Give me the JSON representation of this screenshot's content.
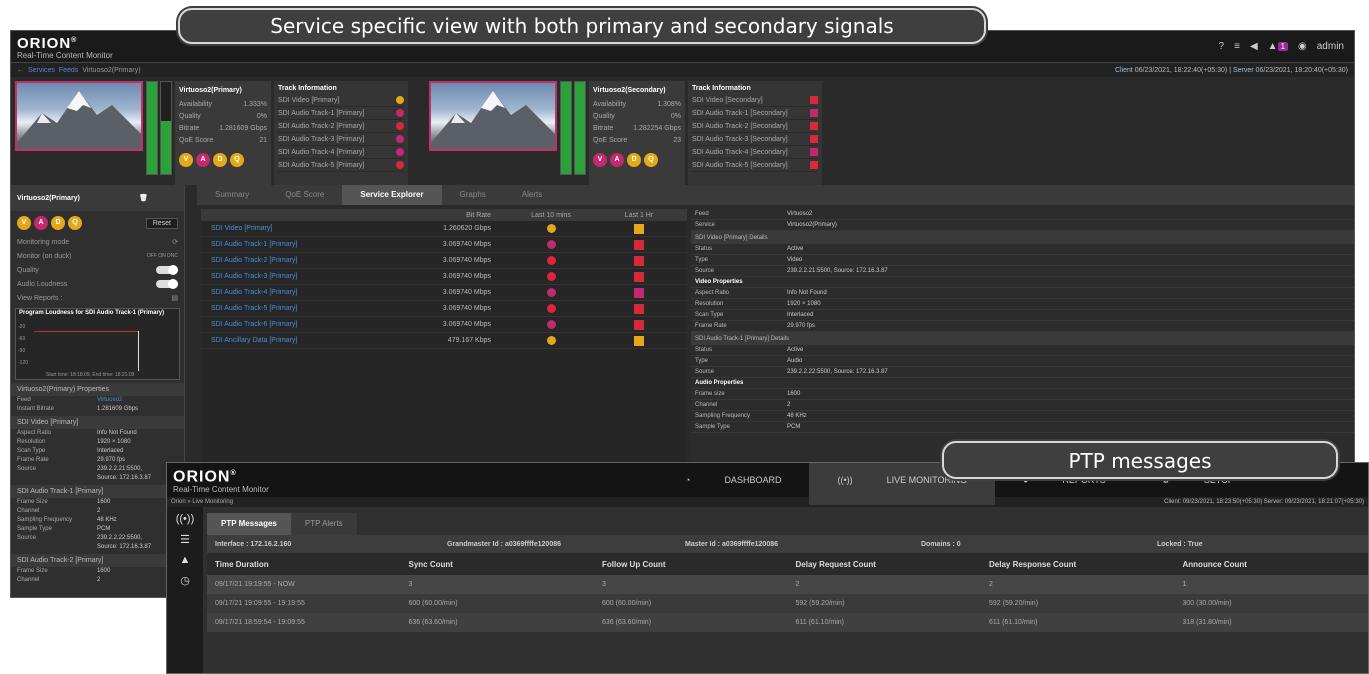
{
  "callouts": {
    "main": "Service specific view with both primary and secondary signals",
    "ptp": "PTP messages"
  },
  "app": {
    "logo": "ORION",
    "reg": "®",
    "subtitle": "Real-Time Content Monitor",
    "user": "admin",
    "badge": "1"
  },
  "breadcrumb": {
    "services": "Services",
    "feeds": "Feeds",
    "current": "Virtuoso2(Primary)"
  },
  "clock": {
    "client_label": "Client",
    "client": "06/23/2021, 18:22:40(+05:30)",
    "server_label": "Server",
    "server": "06/23/2021, 18:20:40(+05:30)"
  },
  "primary": {
    "name": "Virtuoso2(Primary)",
    "availability_label": "Availability",
    "availability": "1.333%",
    "quality_label": "Quality",
    "quality": "0%",
    "bitrate_label": "Bitrate",
    "bitrate": "1.281609 Gbps",
    "qos_label": "QoE Score",
    "qos": "21",
    "track_title": "Track Information",
    "tracks": [
      "SDI Video [Primary]",
      "SDI Audio Track-1 [Primary]",
      "SDI Audio Track-2 [Primary]",
      "SDI Audio Track-3 [Primary]",
      "SDI Audio Track-4 [Primary]",
      "SDI Audio Track-5 [Primary]"
    ]
  },
  "secondary": {
    "name": "Virtuoso2(Secondary)",
    "availability_label": "Availability",
    "availability": "1.308%",
    "quality_label": "Quality",
    "quality": "0%",
    "bitrate_label": "Bitrate",
    "bitrate": "1.282254 Gbps",
    "qos_label": "QoE Score",
    "qos": "23",
    "track_title": "Track Information",
    "tracks": [
      "SDI Video [Secondary]",
      "SDI Audio Track-1 [Secondary]",
      "SDI Audio Track-2 [Secondary]",
      "SDI Audio Track-3 [Secondary]",
      "SDI Audio Track-4 [Secondary]",
      "SDI Audio Track-5 [Secondary]"
    ]
  },
  "vadq": [
    "V",
    "A",
    "D",
    "Q"
  ],
  "left": {
    "title": "Virtuoso2(Primary)",
    "reset": "Reset",
    "monitoring_mode": "Monitoring mode",
    "monitor_duck": "Monitor (on duck)",
    "duck_opts": "OFF ON DNC",
    "quality": "Quality",
    "audio_loudness": "Audio Loudness",
    "view_reports": "View Reports :",
    "graph_title": "Program Loudness for SDI Audio Track-1 (Primary)",
    "graph_y": [
      "-20",
      "-60",
      "-90",
      "-120"
    ],
    "graph_ylabel": "LKFS",
    "graph_time": "Start time: 18:18:09, End time: 18:21:09",
    "props_title": "Virtuoso2(Primary) Properties",
    "feed_k": "Feed",
    "feed_v": "Virtuoso2",
    "instant_bitrate_k": "Instant Bitrate",
    "instant_bitrate_v": "1.281609 Gbps",
    "video_sect": "SDI Video [Primary]",
    "aspect_k": "Aspect Ratio",
    "aspect_v": "Info Not Found",
    "res_k": "Resolution",
    "res_v": "1920 × 1080",
    "scan_k": "Scan Type",
    "scan_v": "Interlaced",
    "frame_k": "Frame Rate",
    "frame_v": "29.970 fps",
    "source_k": "Source",
    "source_v": "239.2.2.21:5500, Source: 172.16.3.87",
    "a1_sect": "SDI Audio Track-1 [Primary]",
    "fsize_k": "Frame Size",
    "fsize_v": "1600",
    "chan_k": "Channel",
    "chan_v": "2",
    "sfreq_k": "Sampling Frequency",
    "sfreq_v": "48 KHz",
    "stype_k": "Sample Type",
    "stype_v": "PCM",
    "a1_source_v": "239.2.2.22:5500, Source: 172.16.3.87",
    "a2_sect": "SDI Audio Track-2 [Primary]",
    "a2_fsize_v": "1600",
    "a2_chan_v": "2"
  },
  "center_tabs": [
    "Summary",
    "QoE Score",
    "Service Explorer",
    "Graphs",
    "Alerts"
  ],
  "explorer": {
    "headers": [
      "",
      "Bit Rate",
      "Last 10 mins",
      "Last 1 Hr"
    ],
    "rows": [
      {
        "name": "SDI Video [Primary]",
        "rate": "1.260620 Gbps",
        "c10": "#e4a818",
        "c1h": "#e4a818",
        "shape10": "dot"
      },
      {
        "name": "SDI Audio Track-1 [Primary]",
        "rate": "3.069740 Mbps",
        "c10": "#c2296e",
        "c1h": "#d9283a",
        "shape10": "dot"
      },
      {
        "name": "SDI Audio Track-2 [Primary]",
        "rate": "3.069740 Mbps",
        "c10": "#d9283a",
        "c1h": "#d9283a",
        "shape10": "dot"
      },
      {
        "name": "SDI Audio Track-3 [Primary]",
        "rate": "3.069740 Mbps",
        "c10": "#d9283a",
        "c1h": "#d9283a",
        "shape10": "dot"
      },
      {
        "name": "SDI Audio Track-4 [Primary]",
        "rate": "3.069740 Mbps",
        "c10": "#c2296e",
        "c1h": "#c2296e",
        "shape10": "dot"
      },
      {
        "name": "SDI Audio Track-5 [Primary]",
        "rate": "3.069740 Mbps",
        "c10": "#d9283a",
        "c1h": "#d9283a",
        "shape10": "dot"
      },
      {
        "name": "SDI Audio Track-6 [Primary]",
        "rate": "3.069740 Mbps",
        "c10": "#c2296e",
        "c1h": "#d9283a",
        "shape10": "dot"
      },
      {
        "name": "SDI Ancillary Data [Primary]",
        "rate": "479.167 Kbps",
        "c10": "#e4a818",
        "c1h": "#e4a818",
        "shape10": "dot"
      }
    ]
  },
  "details": {
    "feed_k": "Feed",
    "feed_v": "Virtuoso2",
    "service_k": "Service",
    "service_v": "Virtuoso2(Primary)",
    "video_sect": "SDI Video [Primary] Details",
    "status_k": "Status",
    "status_v": "Active",
    "type_k": "Type",
    "type_v": "Video",
    "source_k": "Source",
    "source_v": "239.2.2.21:5500, Source: 172.16.3.87",
    "vprops": "Video Properties",
    "aspect_k": "Aspect Ratio",
    "aspect_v": "Info Not Found",
    "res_k": "Resolution",
    "res_v": "1920 × 1080",
    "scan_k": "Scan Type",
    "scan_v": "Interlaced",
    "frame_k": "Frame Rate",
    "frame_v": "29.970 fps",
    "a1_sect": "SDI Audio Track-1 [Primary] Details",
    "a_status_v": "Active",
    "a_type_v": "Audio",
    "a_source_v": "239.2.2.22:5500, Source: 172.16.3.87",
    "aprops": "Audio Properties",
    "fsize_k": "Frame size",
    "fsize_v": "1600",
    "chan_k": "Channel",
    "chan_v": "2",
    "sfreq_k": "Sampling Frequency",
    "sfreq_v": "48 KHz",
    "stype_k": "Sample Type",
    "stype_v": "PCM"
  },
  "ptp": {
    "logo": "ORION",
    "subtitle": "Real-Time Content Monitor",
    "nav": [
      "DASHBOARD",
      "LIVE MONITORING",
      "REPORTS",
      "SETUP"
    ],
    "crumb": "Orion » Live Monitoring",
    "clock": "Client: 09/23/2021, 18:23:50(+05:30)  Server: 09/23/2021, 18:21:07(+05:30)",
    "tabs": [
      "PTP Messages",
      "PTP Alerts"
    ],
    "interface": "Interface : 172.16.2.160",
    "grandmaster": "Grandmaster Id : a0369ffffe120086",
    "master": "Master Id : a0369ffffe120086",
    "domains": "Domains : 0",
    "locked": "Locked : True",
    "headers": [
      "Time Duration",
      "Sync Count",
      "Follow Up Count",
      "Delay Request Count",
      "Delay Response Count",
      "Announce Count"
    ],
    "rows": [
      [
        "09/17/21 19:19:55 - NOW",
        "3",
        "3",
        "2",
        "2",
        "1"
      ],
      [
        "09/17/21 19:09:55 - 19:19:55",
        "600 (60.00/min)",
        "600 (60.00/min)",
        "592 (59.20/min)",
        "592 (59.20/min)",
        "300 (30.00/min)"
      ],
      [
        "09/17/21 18:59:54 - 19:09:55",
        "636 (63.60/min)",
        "636 (63.60/min)",
        "611 (61.10/min)",
        "611 (61.10/min)",
        "318 (31.80/min)"
      ]
    ]
  }
}
